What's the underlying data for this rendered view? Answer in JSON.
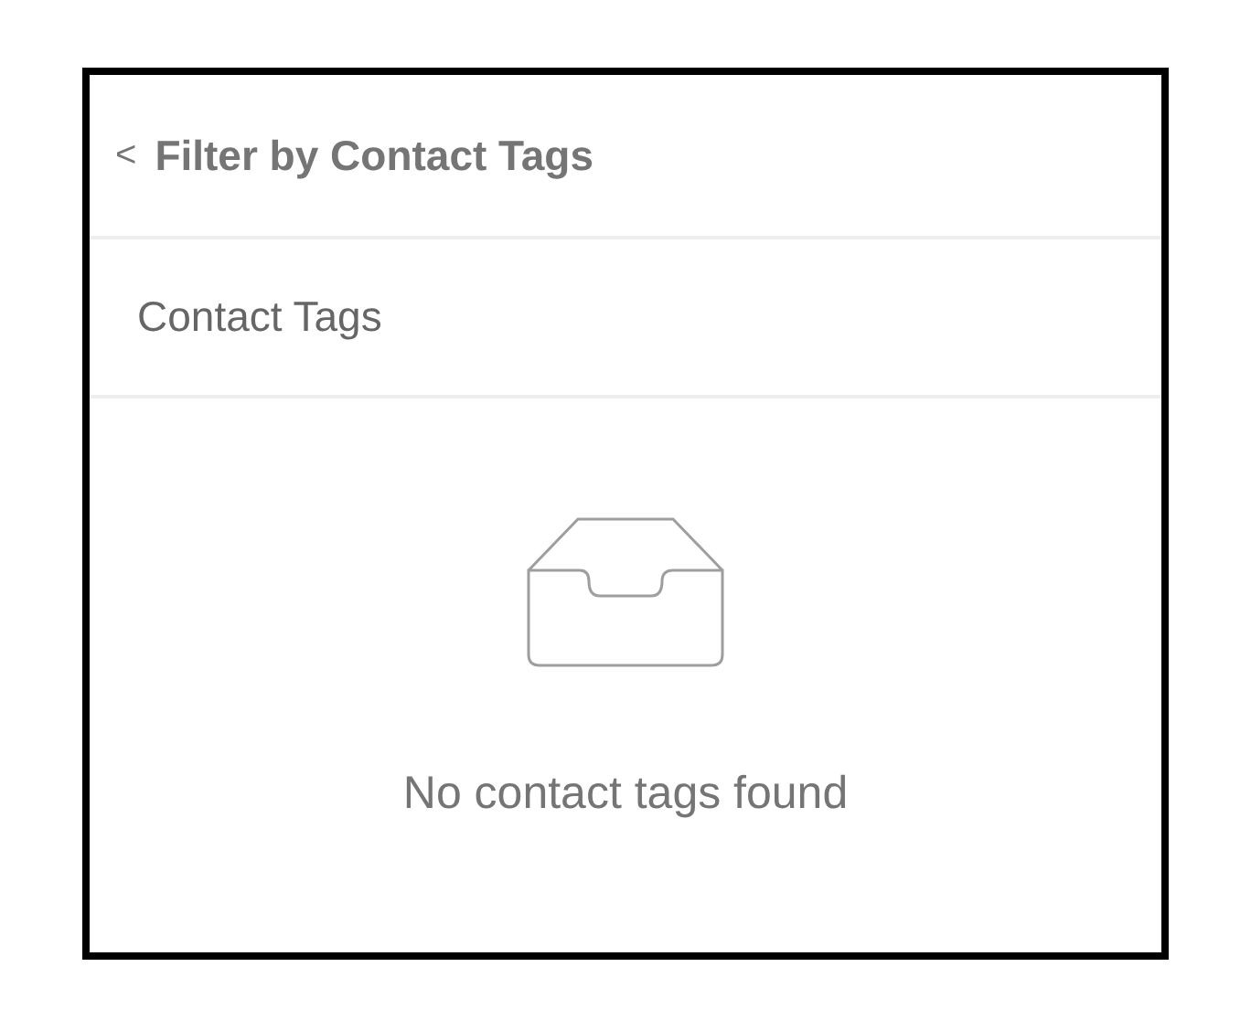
{
  "header": {
    "back_glyph": "<",
    "title": "Filter by Contact Tags"
  },
  "section": {
    "label": "Contact Tags"
  },
  "empty_state": {
    "message": "No contact tags found"
  }
}
